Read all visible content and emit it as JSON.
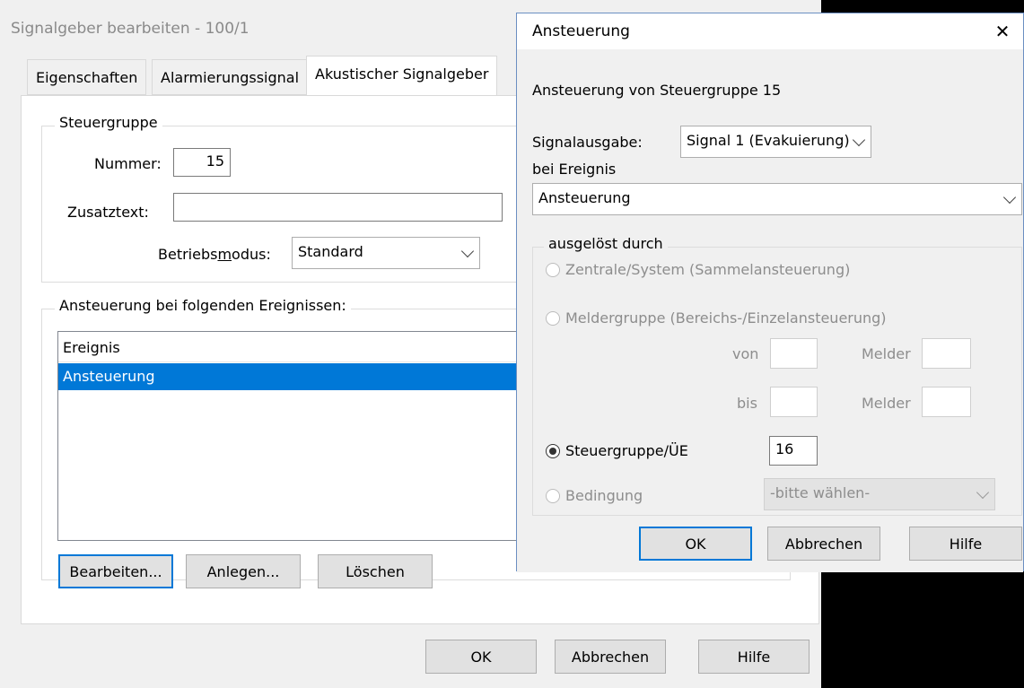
{
  "main_window": {
    "title": "Signalgeber bearbeiten - 100/1",
    "tabs": [
      {
        "label": "Eigenschaften",
        "active": false
      },
      {
        "label": "Alarmierungssignal",
        "active": false
      },
      {
        "label": "Akustischer Signalgeber",
        "active": true
      }
    ],
    "steuergruppe": {
      "legend": "Steuergruppe",
      "nummer_label": "Nummer:",
      "nummer_value": "15",
      "zusatztext_label": "Zusatztext:",
      "zusatztext_value": "",
      "betriebsmodus_label_pre": "Betriebs",
      "betriebsmodus_label_underlined": "m",
      "betriebsmodus_label_post": "odus:",
      "betriebsmodus_value": "Standard"
    },
    "events": {
      "legend": "Ansteuerung bei folgenden Ereignissen:",
      "column_header": "Ereignis",
      "rows": [
        "Ansteuerung"
      ],
      "buttons": {
        "edit": "Bearbeiten...",
        "create": "Anlegen...",
        "delete": "Löschen"
      }
    },
    "footer": {
      "ok": "OK",
      "cancel": "Abbrechen",
      "help": "Hilfe"
    }
  },
  "dialog": {
    "title": "Ansteuerung",
    "close_symbol": "✕",
    "heading": "Ansteuerung von Steuergruppe 15",
    "signalausgabe_label": "Signalausgabe:",
    "signalausgabe_value": "Signal 1 (Evakuierung)",
    "bei_ereignis_label": "bei Ereignis",
    "ereignis_value": "Ansteuerung",
    "ausgeloest": {
      "legend": "ausgelöst durch",
      "options": {
        "zentrale": "Zentrale/System (Sammelansteuerung)",
        "meldergruppe": "Meldergruppe (Bereichs-/Einzelansteuerung)",
        "steuergruppe": "Steuergruppe/ÜE",
        "bedingung": "Bedingung"
      },
      "selected": "steuergruppe",
      "von_label": "von",
      "bis_label": "bis",
      "melder_label": "Melder",
      "steuergruppe_value": "16",
      "bedingung_value": "-bitte wählen-"
    },
    "buttons": {
      "ok": "OK",
      "cancel": "Abbrechen",
      "help": "Hilfe"
    }
  },
  "colors": {
    "accent": "#0078d7",
    "dialog_border": "#6b8fc2",
    "disabled_text": "#8d8d8d"
  }
}
